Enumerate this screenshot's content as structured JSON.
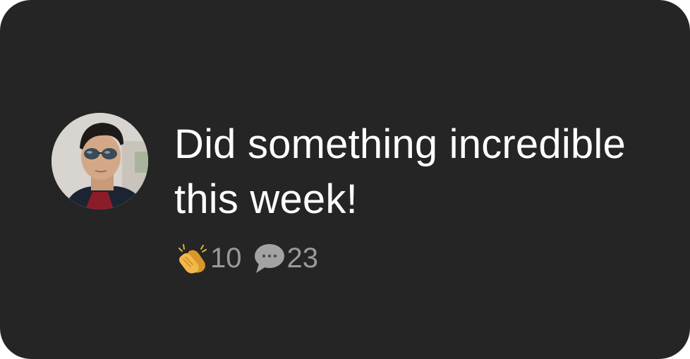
{
  "post": {
    "avatar_icon": "user-avatar-photo",
    "text": "Did something incredible this week!",
    "reactions": [
      {
        "icon": "clapping-hands-icon",
        "count": "10"
      },
      {
        "icon": "speech-bubble-icon",
        "count": "23"
      }
    ]
  },
  "colors": {
    "card_background": "#252525",
    "text_primary": "#ffffff",
    "text_secondary": "#9a9a9a"
  }
}
